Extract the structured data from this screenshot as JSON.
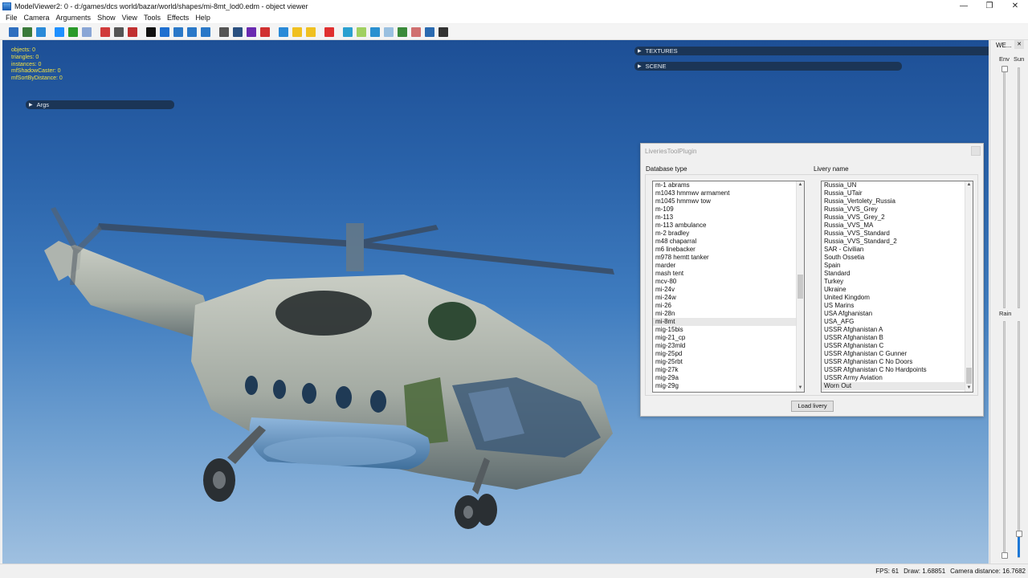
{
  "window": {
    "title": "ModelViewer2: 0 - d:/games/dcs world/bazar/world/shapes/mi-8mt_lod0.edm - object viewer",
    "minimize": "—",
    "maximize": "❐",
    "close": "✕"
  },
  "menu": [
    "File",
    "Camera",
    "Arguments",
    "Show",
    "View",
    "Tools",
    "Effects",
    "Help"
  ],
  "toolbar": {
    "button_colors": [
      "#2f6fbf",
      "#3a7a3a",
      "#2a8ad8",
      "#1e90ff",
      "#2a9a2a",
      "#8aa6d6",
      "#d03a3a",
      "#555",
      "#c03030",
      "#111",
      "#1e6fd0",
      "#2a78c8",
      "#2a78c8",
      "#2a78c8",
      "#555",
      "#2a5080",
      "#6a2ab0",
      "#d03030",
      "#2a8ad8",
      "#f0c020",
      "#f0c020",
      "#e03030",
      "#2aa0d0",
      "#a0d060",
      "#2a90d0",
      "#9ac0e0",
      "#3a8a3a",
      "#d07070",
      "#2a6ab0",
      "#333"
    ]
  },
  "stats": [
    "objects: 0",
    "triangles: 0",
    "instances: 0",
    "mfShadowCaster: 0",
    "mfSortByDistance: 0"
  ],
  "panels": {
    "args": "Args",
    "textures": "TEXTURES",
    "scene": "SCENE"
  },
  "plugin": {
    "title": "LiveriesToolPlugin",
    "database_label": "Database type",
    "livery_label": "Livery name",
    "load_button": "Load livery",
    "database_items": [
      "m-1 abrams",
      "m1043 hmmwv armament",
      "m1045 hmmwv tow",
      "m-109",
      "m-113",
      "m-113 ambulance",
      "m-2 bradley",
      "m48 chaparral",
      "m6 linebacker",
      "m978 hemtt tanker",
      "marder",
      "mash tent",
      "mcv-80",
      "mi-24v",
      "mi-24w",
      "mi-26",
      "mi-28n",
      "mi-8mt",
      "mig-15bis",
      "mig-21_cp",
      "mig-23mld",
      "mig-25pd",
      "mig-25rbt",
      "mig-27k",
      "mig-29a",
      "mig-29g"
    ],
    "database_selected": "mi-8mt",
    "livery_items": [
      "Russia_UN",
      "Russia_UTair",
      "Russia_Vertolety_Russia",
      "Russia_VVS_Grey",
      "Russia_VVS_Grey_2",
      "Russia_VVS_MA",
      "Russia_VVS_Standard",
      "Russia_VVS_Standard_2",
      "SAR - Civilian",
      "South Ossetia",
      "Spain",
      "Standard",
      "Turkey",
      "Ukraine",
      "United Kingdom",
      "US Marins",
      "USA Afghanistan",
      "USA_AFG",
      "USSR Afghanistan A",
      "USSR Afghanistan B",
      "USSR Afghanistan C",
      "USSR Afghanistan C Gunner",
      "USSR Afghanistan C No Doors",
      "USSR Afghanistan C No Hardpoints",
      "USSR Army Aviation",
      "Worn Out"
    ],
    "livery_selected": "Worn Out"
  },
  "weather": {
    "title": "WE...",
    "close": "✕",
    "env": "Env",
    "sun": "Sun",
    "rain": "Rain",
    "rain_level": 0.1
  },
  "status": {
    "fps": "FPS: 61",
    "draw": "Draw: 1.68851",
    "camera": "Camera distance: 16.7682"
  },
  "colors": {
    "sky_top": "#1d4f96",
    "sky_bottom": "#9fc0e0",
    "stats_text": "#f2e040",
    "panel_bar": "#1b3556",
    "slider_fill": "#1e78d6"
  }
}
